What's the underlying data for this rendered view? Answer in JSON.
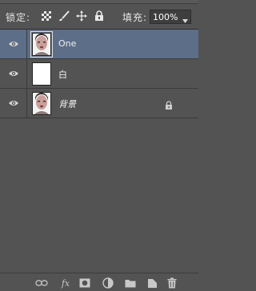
{
  "lockbar": {
    "lock_label": "锁定:",
    "fill_label": "填充:",
    "fill_value": "100%"
  },
  "icons": {
    "lock_transparent": "checkerboard-icon",
    "lock_image": "brush-icon",
    "lock_position": "move-arrows-icon",
    "lock_all": "padlock-icon",
    "visibility": "eye-icon",
    "dropdown": "triangle-down-icon"
  },
  "layers": [
    {
      "name": "One",
      "selected": true,
      "visible": true,
      "thumbnail": "portrait",
      "locked": false
    },
    {
      "name": "白",
      "selected": false,
      "visible": true,
      "thumbnail": "white",
      "locked": false
    },
    {
      "name": "背景",
      "selected": false,
      "visible": true,
      "thumbnail": "portrait",
      "locked": true
    }
  ],
  "bottombar": {
    "fx_label": "fx",
    "buttons": [
      "link-icon",
      "fx-icon",
      "mask-icon",
      "adjustment-icon",
      "folder-icon",
      "new-layer-icon",
      "trash-icon"
    ]
  }
}
